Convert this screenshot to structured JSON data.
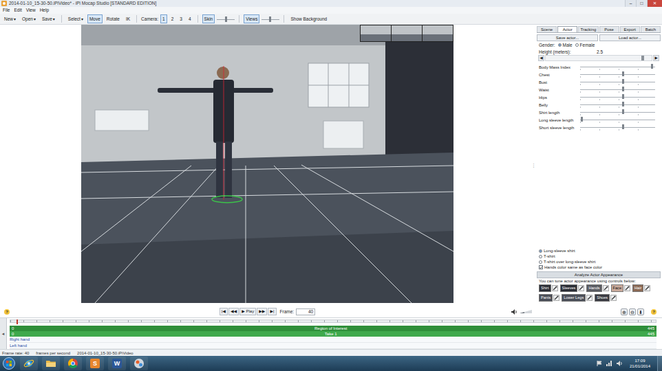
{
  "window": {
    "title": "2014-01-10_15-30-50.iPiVideo* - iPi Mocap Studio [STANDARD EDITION]",
    "controls": [
      "–",
      "□",
      "✕"
    ]
  },
  "menu": [
    "File",
    "Edit",
    "View",
    "Help"
  ],
  "toolbar": [
    [
      {
        "kind": "button",
        "label": "New",
        "arrow": "▾"
      },
      {
        "kind": "button",
        "label": "Open",
        "arrow": "▾"
      },
      {
        "kind": "button",
        "label": "Save",
        "arrow": "▾"
      }
    ],
    [
      {
        "kind": "button",
        "label": "Select",
        "arrow": "▾"
      },
      {
        "kind": "toggle",
        "label": "Move",
        "selected": true
      },
      {
        "kind": "toggle",
        "label": "Rotate",
        "selected": false
      },
      {
        "kind": "toggle",
        "label": "IK",
        "selected": false
      }
    ],
    [
      {
        "kind": "label",
        "label": "Camera:"
      },
      {
        "kind": "toggle",
        "label": "1",
        "selected": true
      },
      {
        "kind": "toggle",
        "label": "2",
        "selected": false
      },
      {
        "kind": "toggle",
        "label": "3",
        "selected": false
      },
      {
        "kind": "toggle",
        "label": "4",
        "selected": false
      }
    ],
    [
      {
        "kind": "toggle",
        "label": "Skin",
        "selected": true
      },
      {
        "kind": "slider",
        "level": 0.5
      }
    ],
    [
      {
        "kind": "toggle",
        "label": "Views",
        "selected": true
      },
      {
        "kind": "slider",
        "level": 0.45
      }
    ],
    [
      {
        "kind": "button",
        "label": "Show Background"
      }
    ]
  ],
  "splitter": "⋮",
  "panel": {
    "tabs": [
      {
        "label": "Scene",
        "selected": false
      },
      {
        "label": "Actor",
        "selected": true
      },
      {
        "label": "Tracking",
        "selected": false
      },
      {
        "label": "Pose",
        "selected": false
      },
      {
        "label": "Export",
        "selected": false
      },
      {
        "label": "Batch",
        "selected": false
      }
    ],
    "actions": [
      "Save actor...",
      "Load actor..."
    ],
    "gender": {
      "label": "Gender:",
      "options": [
        {
          "label": "Male",
          "selected": true
        },
        {
          "label": "Female",
          "selected": false
        }
      ]
    },
    "height": {
      "label": "Height (meters):",
      "value": "2.5",
      "level": 0.93,
      "left": "◀",
      "right": "▶"
    },
    "sliders": [
      {
        "label": "Body Mass Index",
        "level": 0.96
      },
      {
        "label": "Chest",
        "level": 0.57
      },
      {
        "label": "Bust",
        "level": 0.57
      },
      {
        "label": "Waist",
        "level": 0.57
      },
      {
        "label": "Hips",
        "level": 0.57
      },
      {
        "label": "Belly",
        "level": 0.57
      },
      {
        "label": "Shirt length",
        "level": 0.57
      },
      {
        "label": "Long sleeve length",
        "level": 0.02
      },
      {
        "label": "Short sleeve length",
        "level": 0.57
      }
    ],
    "garments": [
      {
        "label": "Long-sleeve shirt",
        "selected": true
      },
      {
        "label": "T-shirt",
        "selected": false
      },
      {
        "label": "T-shirt over long-sleeve shirt",
        "selected": false
      }
    ],
    "hands_match": {
      "label": "Hands color same as face color",
      "checked": true
    },
    "appearance": {
      "title": "Analyze Actor Appearance",
      "hint": "You can tune actor appearance using controls below:",
      "swatch_rows": [
        [
          {
            "label": "Shirt",
            "color": "#2b2e36"
          },
          {
            "label": "Sleeves",
            "color": "#2b2e36"
          },
          {
            "label": "Hands",
            "color": "#5a5c62"
          },
          {
            "label": "Face",
            "color": "#c9a99a"
          },
          {
            "label": "Hair",
            "color": "#8c6a55"
          }
        ],
        [
          {
            "label": "Pants",
            "color": "#4b4f59"
          },
          {
            "label": "Lower Legs",
            "color": "#4b4f59"
          },
          {
            "label": "Shoes",
            "color": "#3a3b42"
          }
        ]
      ]
    }
  },
  "playback": {
    "buttons": [
      "|◀",
      "◀◀",
      "▶ Play",
      "▶▶",
      "▶|"
    ],
    "frame_label": "Frame:",
    "frame": "40",
    "volume": {
      "level": 0.4
    },
    "zoom": [
      "⊕",
      "⊖",
      "⬇"
    ],
    "help": "?"
  },
  "timeline": {
    "collapse": "◂",
    "playhead": 0.01,
    "bars": [
      {
        "label": "Region of Interest",
        "start": "0",
        "end": "445",
        "color": "#2f8f3a"
      },
      {
        "label": "Take 1",
        "start": "0",
        "end": "445",
        "color": "#3fa94c"
      }
    ],
    "tracks": [
      "Right hand",
      "Left hand"
    ]
  },
  "status_bar": [
    "Frame rate: 40",
    "frames per second",
    "2014-01-10_15-30-50.iPiVideo"
  ],
  "taskbar": {
    "apps": [
      {
        "kind": "ie"
      },
      {
        "kind": "explorer"
      },
      {
        "kind": "chrome"
      },
      {
        "kind": "sublime",
        "glyph": "S"
      },
      {
        "kind": "word",
        "glyph": "W"
      },
      {
        "kind": "mocap"
      }
    ],
    "time": "17:09",
    "date": "21/01/2014"
  }
}
